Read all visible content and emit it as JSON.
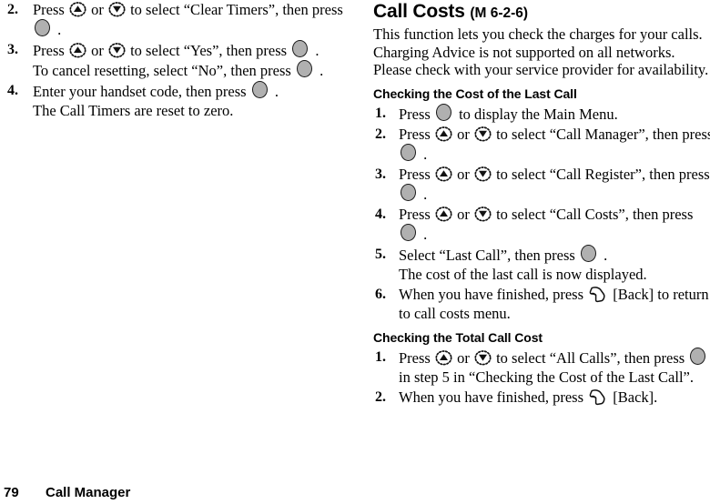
{
  "document": {
    "footer": {
      "page_number": "79",
      "section": "Call Manager"
    }
  },
  "left_column": {
    "steps": [
      {
        "number": "2.",
        "lines": [
          {
            "parts": [
              {
                "type": "text",
                "value": "Press "
              },
              {
                "type": "icon",
                "icon": "nav-up-key-icon"
              },
              {
                "type": "text",
                "value": " or "
              },
              {
                "type": "icon",
                "icon": "nav-down-key-icon"
              },
              {
                "type": "text",
                "value": " to select “Clear Timers”, then press"
              }
            ]
          },
          {
            "parts": [
              {
                "type": "icon",
                "icon": "select-key-icon"
              },
              {
                "type": "text",
                "value": " ."
              }
            ]
          }
        ]
      },
      {
        "number": "3.",
        "lines": [
          {
            "parts": [
              {
                "type": "text",
                "value": "Press "
              },
              {
                "type": "icon",
                "icon": "nav-up-key-icon"
              },
              {
                "type": "text",
                "value": " or "
              },
              {
                "type": "icon",
                "icon": "nav-down-key-icon"
              },
              {
                "type": "text",
                "value": " to select “Yes”, then press "
              },
              {
                "type": "icon",
                "icon": "select-key-icon"
              },
              {
                "type": "text",
                "value": " ."
              }
            ]
          },
          {
            "parts": [
              {
                "type": "text",
                "value": "To cancel resetting, select “No”, then press "
              },
              {
                "type": "icon",
                "icon": "select-key-icon"
              },
              {
                "type": "text",
                "value": " ."
              }
            ]
          }
        ]
      },
      {
        "number": "4.",
        "lines": [
          {
            "parts": [
              {
                "type": "text",
                "value": "Enter your handset code, then press "
              },
              {
                "type": "icon",
                "icon": "select-key-icon"
              },
              {
                "type": "text",
                "value": " ."
              }
            ]
          },
          {
            "parts": [
              {
                "type": "text",
                "value": "The Call Timers are reset to zero."
              }
            ]
          }
        ]
      }
    ]
  },
  "right_column": {
    "title": "Call Costs",
    "menu_reference": "(M 6-2-6)",
    "intro_lines": [
      "This function lets you check the charges for your calls.",
      "Charging Advice is not supported on all networks.",
      "Please check with your service provider for availability."
    ],
    "sections": [
      {
        "heading": "Checking the Cost of the Last Call",
        "steps": [
          {
            "number": "1.",
            "lines": [
              {
                "parts": [
                  {
                    "type": "text",
                    "value": "Press "
                  },
                  {
                    "type": "icon",
                    "icon": "select-key-icon"
                  },
                  {
                    "type": "text",
                    "value": " to display the Main Menu."
                  }
                ]
              }
            ]
          },
          {
            "number": "2.",
            "lines": [
              {
                "parts": [
                  {
                    "type": "text",
                    "value": "Press "
                  },
                  {
                    "type": "icon",
                    "icon": "nav-up-key-icon"
                  },
                  {
                    "type": "text",
                    "value": " or "
                  },
                  {
                    "type": "icon",
                    "icon": "nav-down-key-icon"
                  },
                  {
                    "type": "text",
                    "value": " to select “Call Manager”, then press"
                  }
                ]
              },
              {
                "parts": [
                  {
                    "type": "icon",
                    "icon": "select-key-icon"
                  },
                  {
                    "type": "text",
                    "value": " ."
                  }
                ]
              }
            ]
          },
          {
            "number": "3.",
            "lines": [
              {
                "parts": [
                  {
                    "type": "text",
                    "value": "Press "
                  },
                  {
                    "type": "icon",
                    "icon": "nav-up-key-icon"
                  },
                  {
                    "type": "text",
                    "value": " or "
                  },
                  {
                    "type": "icon",
                    "icon": "nav-down-key-icon"
                  },
                  {
                    "type": "text",
                    "value": " to select “Call Register”, then press"
                  }
                ]
              },
              {
                "parts": [
                  {
                    "type": "icon",
                    "icon": "select-key-icon"
                  },
                  {
                    "type": "text",
                    "value": " ."
                  }
                ]
              }
            ]
          },
          {
            "number": "4.",
            "lines": [
              {
                "parts": [
                  {
                    "type": "text",
                    "value": "Press "
                  },
                  {
                    "type": "icon",
                    "icon": "nav-up-key-icon"
                  },
                  {
                    "type": "text",
                    "value": " or "
                  },
                  {
                    "type": "icon",
                    "icon": "nav-down-key-icon"
                  },
                  {
                    "type": "text",
                    "value": " to select “Call Costs”, then press"
                  }
                ]
              },
              {
                "parts": [
                  {
                    "type": "icon",
                    "icon": "select-key-icon"
                  },
                  {
                    "type": "text",
                    "value": " ."
                  }
                ]
              }
            ]
          },
          {
            "number": "5.",
            "lines": [
              {
                "parts": [
                  {
                    "type": "text",
                    "value": "Select “Last Call”, then press "
                  },
                  {
                    "type": "icon",
                    "icon": "select-key-icon"
                  },
                  {
                    "type": "text",
                    "value": " ."
                  }
                ]
              },
              {
                "parts": [
                  {
                    "type": "text",
                    "value": "The cost of the last call is now displayed."
                  }
                ]
              }
            ]
          },
          {
            "number": "6.",
            "lines": [
              {
                "parts": [
                  {
                    "type": "text",
                    "value": "When you have finished, press "
                  },
                  {
                    "type": "icon",
                    "icon": "soft-key-back-icon"
                  },
                  {
                    "type": "text",
                    "value": " [Back] to return"
                  }
                ]
              },
              {
                "parts": [
                  {
                    "type": "text",
                    "value": "to call costs menu."
                  }
                ]
              }
            ]
          }
        ]
      },
      {
        "heading": "Checking the Total Call Cost",
        "steps": [
          {
            "number": "1.",
            "lines": [
              {
                "parts": [
                  {
                    "type": "text",
                    "value": "Press "
                  },
                  {
                    "type": "icon",
                    "icon": "nav-up-key-icon"
                  },
                  {
                    "type": "text",
                    "value": " or "
                  },
                  {
                    "type": "icon",
                    "icon": "nav-down-key-icon"
                  },
                  {
                    "type": "text",
                    "value": " to select “All Calls”, then press "
                  },
                  {
                    "type": "icon",
                    "icon": "select-key-icon"
                  }
                ]
              },
              {
                "parts": [
                  {
                    "type": "text",
                    "value": "in step 5 in “Checking the Cost of the Last Call”."
                  }
                ]
              }
            ]
          },
          {
            "number": "2.",
            "lines": [
              {
                "parts": [
                  {
                    "type": "text",
                    "value": "When you have finished, press "
                  },
                  {
                    "type": "icon",
                    "icon": "soft-key-back-icon"
                  },
                  {
                    "type": "text",
                    "value": " [Back]."
                  }
                ]
              }
            ]
          }
        ]
      }
    ]
  },
  "icons": {
    "select-key-icon": "center-select-key",
    "nav-up-key-icon": "navigation-up-key",
    "nav-down-key-icon": "navigation-down-key",
    "soft-key-back-icon": "left-soft-key"
  },
  "colors": {
    "key_fill": "#b0b0b0",
    "key_outline": "#1a1a1a",
    "text": "#000000",
    "background": "#ffffff"
  }
}
